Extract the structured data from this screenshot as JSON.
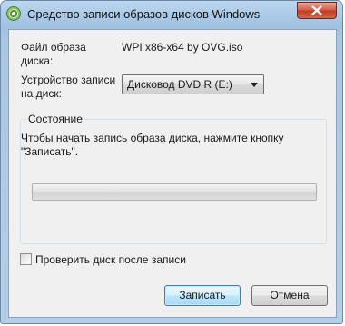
{
  "window": {
    "title": "Средство записи образов дисков Windows"
  },
  "form": {
    "file_label": "Файл образа диска:",
    "file_value": "WPI x86-x64 by OVG.iso",
    "device_label": "Устройство записи на диск:",
    "device_selected": "Дисковод DVD R (E:)"
  },
  "status": {
    "group_title": "Состояние",
    "message": "Чтобы начать запись образа диска, нажмите кнопку \"Записать\".",
    "progress": 0
  },
  "verify": {
    "label": "Проверить диск после записи",
    "checked": false
  },
  "buttons": {
    "burn": "Записать",
    "cancel": "Отмена"
  },
  "colors": {
    "frame": "#a9c8e6",
    "client": "#f0f0f0",
    "close": "#c94a31",
    "primary_border": "#3c7fb1"
  },
  "icons": {
    "app": "disc-burner-icon",
    "close": "close-icon",
    "dropdown": "chevron-down-icon"
  }
}
